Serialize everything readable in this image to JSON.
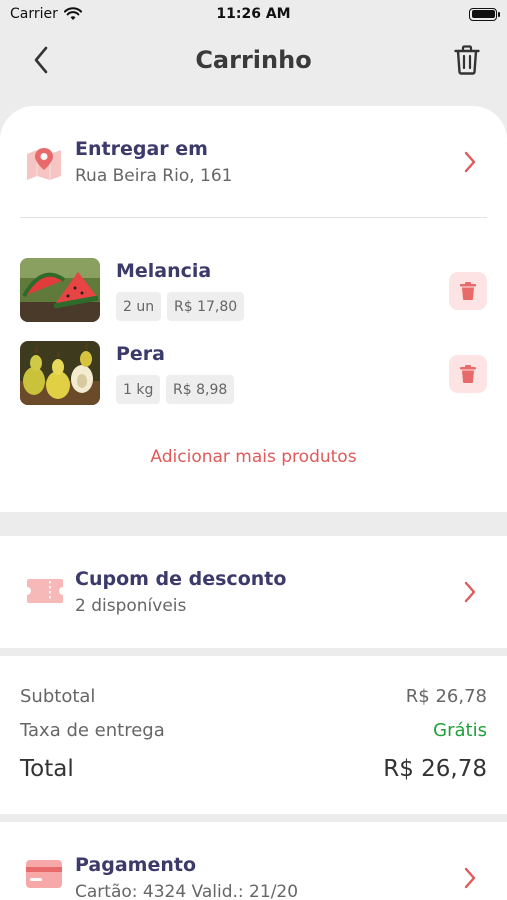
{
  "status_bar": {
    "carrier": "Carrier",
    "time": "11:26 AM"
  },
  "nav": {
    "title": "Carrinho"
  },
  "delivery": {
    "title": "Entregar em",
    "address": "Rua Beira Rio, 161"
  },
  "products": [
    {
      "name": "Melancia",
      "quantity": "2 un",
      "price": "R$ 17,80"
    },
    {
      "name": "Pera",
      "quantity": "1 kg",
      "price": "R$ 8,98"
    }
  ],
  "add_more_label": "Adicionar mais produtos",
  "coupon": {
    "title": "Cupom de desconto",
    "subtitle": "2 disponíveis"
  },
  "summary": {
    "subtotal_label": "Subtotal",
    "subtotal_value": "R$ 26,78",
    "delivery_fee_label": "Taxa de entrega",
    "delivery_fee_value": "Grátis",
    "total_label": "Total",
    "total_value": "R$ 26,78"
  },
  "payment": {
    "title": "Pagamento",
    "details": "Cartão: 4324 Valid.: 21/20"
  },
  "colors": {
    "accent": "#e05a5a",
    "title_text": "#3c3a6b",
    "free_green": "#1fa03a",
    "icon_pink": "#f4a5a5",
    "delete_bg": "#fde3e3"
  },
  "icons": {
    "back": "chevron-left-icon",
    "trash": "trash-icon",
    "map": "map-pin-icon",
    "coupon": "ticket-icon",
    "payment": "credit-card-icon"
  }
}
